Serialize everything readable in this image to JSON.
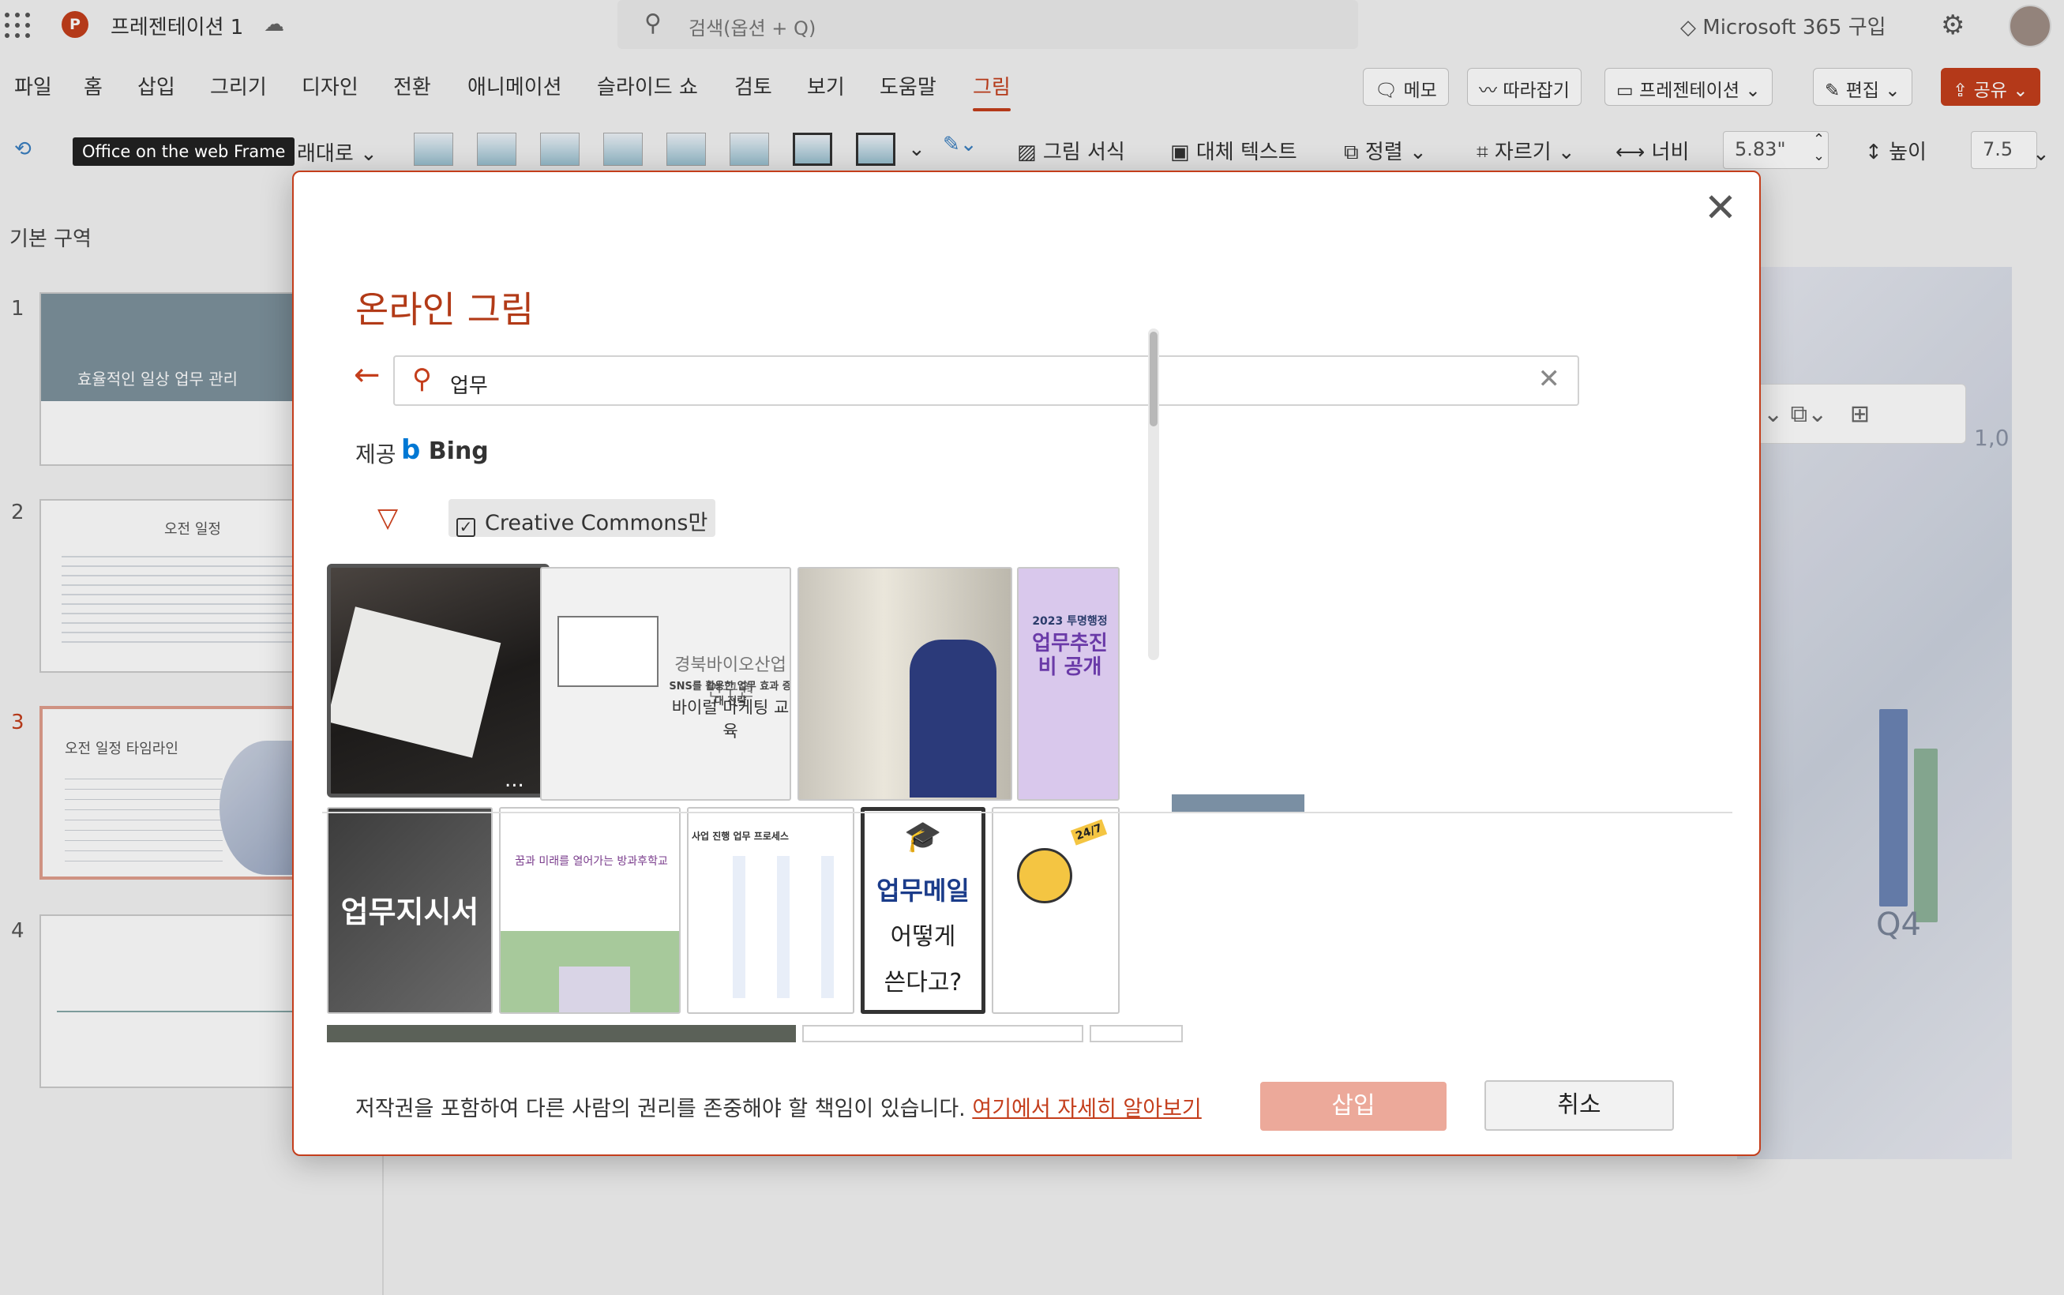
{
  "app": {
    "doc_title": "프레젠테이션 1",
    "search_placeholder": "검색(옵션 + Q)",
    "ms365": "Microsoft 365 구입"
  },
  "menu": [
    "파일",
    "홈",
    "삽입",
    "그리기",
    "디자인",
    "전환",
    "애니메이션",
    "슬라이드 쇼",
    "검토",
    "보기",
    "도움말",
    "그림"
  ],
  "menu_active": "그림",
  "header_buttons": {
    "memo": "메모",
    "follow": "따라잡기",
    "present": "프레젠테이션",
    "edit": "편집",
    "share": "공유"
  },
  "ribbon": {
    "tooltip": "Office on the web Frame",
    "partial_label": "래대로",
    "format": "그림 서식",
    "alt_text": "대체 텍스트",
    "arrange": "정렬",
    "crop": "자르기",
    "width_label": "너비",
    "width_value": "5.83\"",
    "height_label": "높이",
    "height_value": "7.5"
  },
  "left_pane": {
    "section": "기본 구역",
    "slides": [
      {
        "num": "1",
        "title": "효율적인 일상 업무 관리"
      },
      {
        "num": "2",
        "title": "오전 일정"
      },
      {
        "num": "3",
        "title": "오전 일정 타임라인"
      },
      {
        "num": "4",
        "title": ""
      }
    ]
  },
  "canvas": {
    "label": "Q4",
    "axis_label": "1,0"
  },
  "dialog": {
    "title": "온라인 그림",
    "search_value": "업무",
    "provider_prefix": "제공",
    "provider_name": "Bing",
    "filter_label": "Creative Commons만",
    "images": {
      "img2_title": "경북바이오산업연구원",
      "img2_sub": "SNS를 활용한 업무 효과 증대 전략",
      "img2_main": "바이럴 마케팅 교육",
      "img4_top": "2023 투명행정",
      "img4_main": "업무추진비 공개",
      "img5_text": "업무지시서",
      "img6_text": "꿈과 미래를 열어가는 방과후학교",
      "img7_title": "사업 진행 업무 프로세스",
      "img8_line1": "업무메일",
      "img8_line2": "어떻게",
      "img8_line3": "쓴다고?",
      "img9_badge": "24/7",
      "more": "..."
    },
    "disclaimer": "저작권을 포함하여 다른 사람의 권리를 존중해야 할 책임이 있습니다.",
    "learn_more": "여기에서 자세히 알아보기",
    "insert": "삽입",
    "cancel": "취소"
  },
  "colors": {
    "accent": "#c43e1c",
    "insert_disabled": "#eca99a"
  }
}
